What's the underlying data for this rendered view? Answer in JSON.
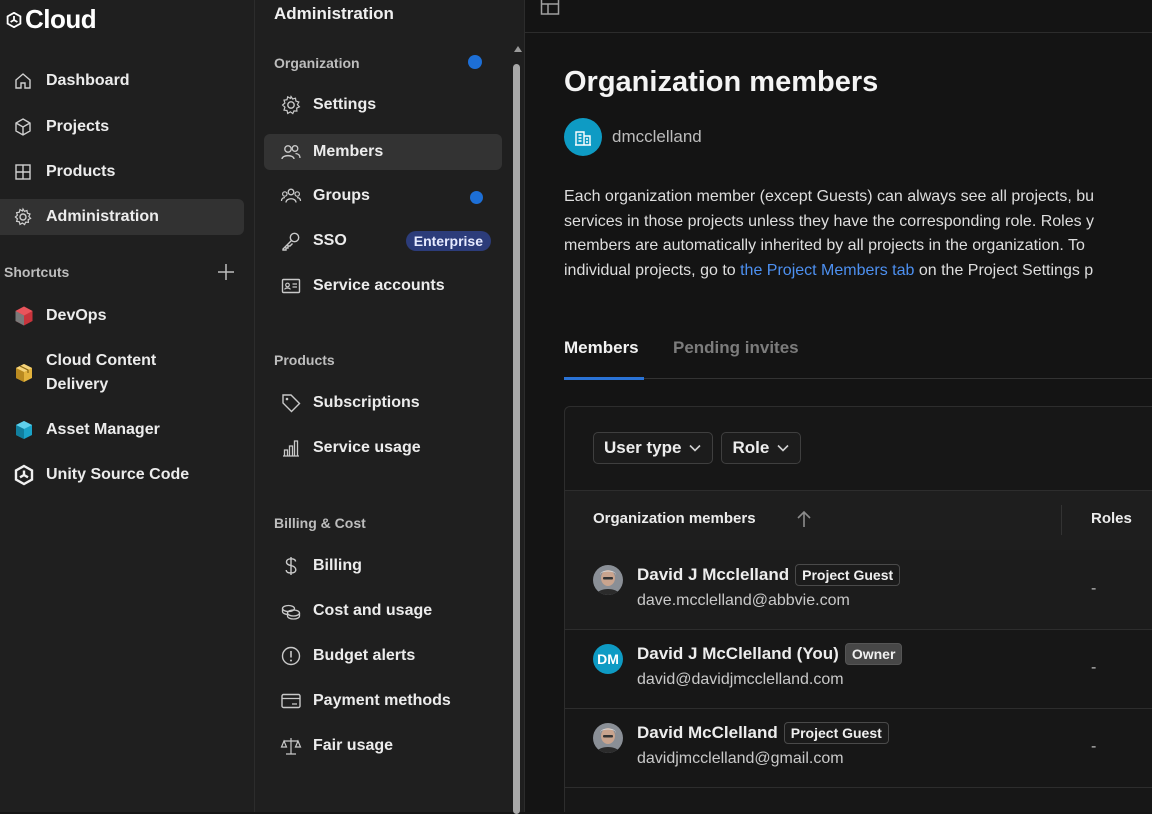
{
  "brand": {
    "name": "Cloud",
    "logo_icon": "unity-logo-icon"
  },
  "nav": {
    "items": [
      {
        "label": "Dashboard",
        "icon": "home-icon"
      },
      {
        "label": "Projects",
        "icon": "cube-icon"
      },
      {
        "label": "Products",
        "icon": "grid-icon"
      },
      {
        "label": "Administration",
        "icon": "gear-icon",
        "active": true
      }
    ],
    "shortcuts_label": "Shortcuts",
    "shortcuts": [
      {
        "label": "DevOps",
        "icon": "devops-icon"
      },
      {
        "label": "Cloud Content Delivery",
        "line1": "Cloud Content",
        "line2": "Delivery",
        "icon": "ccd-box-icon"
      },
      {
        "label": "Asset Manager",
        "icon": "asset-manager-icon"
      },
      {
        "label": "Unity Source Code",
        "icon": "unity-logo-icon"
      }
    ]
  },
  "subnav": {
    "title": "Administration",
    "sections": [
      {
        "label": "Organization",
        "items": [
          {
            "label": "Settings",
            "icon": "gear-icon"
          },
          {
            "label": "Members",
            "icon": "people-icon",
            "active": true
          },
          {
            "label": "Groups",
            "icon": "group-icon"
          },
          {
            "label": "SSO",
            "icon": "key-icon",
            "badge": "Enterprise"
          },
          {
            "label": "Service accounts",
            "icon": "id-card-icon"
          }
        ]
      },
      {
        "label": "Products",
        "items": [
          {
            "label": "Subscriptions",
            "icon": "tag-icon"
          },
          {
            "label": "Service usage",
            "icon": "bar-chart-icon"
          }
        ]
      },
      {
        "label": "Billing & Cost",
        "items": [
          {
            "label": "Billing",
            "icon": "dollar-icon"
          },
          {
            "label": "Cost and usage",
            "icon": "coins-icon"
          },
          {
            "label": "Budget alerts",
            "icon": "alert-circle-icon"
          },
          {
            "label": "Payment methods",
            "icon": "credit-card-icon"
          },
          {
            "label": "Fair usage",
            "icon": "scale-icon"
          }
        ]
      }
    ]
  },
  "main": {
    "title": "Organization members",
    "org_name": "dmcclelland",
    "description": {
      "line1": "Each organization member (except Guests) can always see all projects, bu",
      "line2": "services in those projects unless they have the corresponding role. Roles y",
      "line3": "members are automatically inherited by all projects in the organization. To",
      "line4_pre": "individual projects, go to ",
      "line4_link": "the Project Members tab",
      "line4_post": " on the Project Settings p"
    },
    "tabs": [
      {
        "label": "Members",
        "active": true
      },
      {
        "label": "Pending invites"
      }
    ],
    "filters": [
      {
        "label": "User type"
      },
      {
        "label": "Role"
      }
    ],
    "table": {
      "columns": [
        "Organization members",
        "Roles"
      ],
      "rows": [
        {
          "name": "David J Mcclelland",
          "badge": "Project Guest",
          "email": "dave.mcclelland@abbvie.com",
          "role": "-",
          "avatar": "photo"
        },
        {
          "name": "David J McClelland (You)",
          "badge": "Owner",
          "email": "david@davidjmcclelland.com",
          "role": "-",
          "avatar": "initials",
          "initials": "DM"
        },
        {
          "name": "David McClelland",
          "badge": "Project Guest",
          "email": "davidjmcclelland@gmail.com",
          "role": "-",
          "avatar": "photo"
        }
      ]
    }
  },
  "colors": {
    "accent": "#2a73d6",
    "link": "#4d90f0",
    "dot": "#1d6fd6",
    "enterprise_badge": "#2c3c7a",
    "avatar_teal": "#0e9bc4"
  }
}
